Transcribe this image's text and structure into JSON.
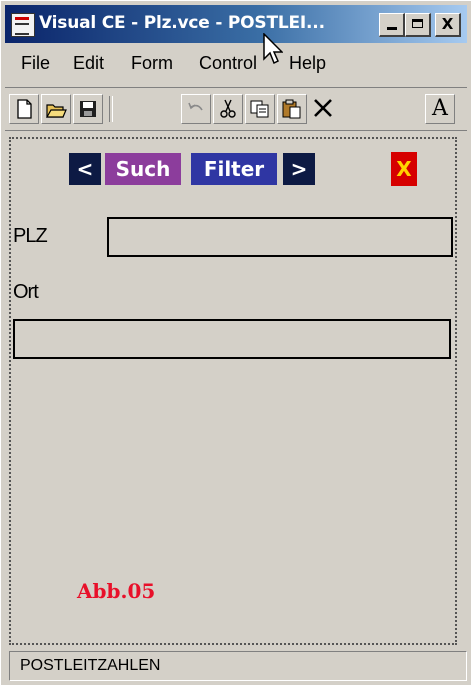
{
  "window": {
    "title": "Visual CE - Plz.vce - POSTLEI...",
    "minimize_icon": "minimize-icon",
    "maximize_icon": "maximize-icon",
    "close_label": "X"
  },
  "menu": {
    "items": [
      {
        "label": "File"
      },
      {
        "label": "Edit"
      },
      {
        "label": "Form"
      },
      {
        "label": "Control"
      },
      {
        "label": "Help"
      }
    ]
  },
  "toolbar": {
    "buttons": [
      "new-file-icon",
      "open-folder-icon",
      "save-icon",
      "undo-icon",
      "cut-icon",
      "copy-icon",
      "paste-icon",
      "delete-icon"
    ],
    "text_tool_label": "A"
  },
  "form": {
    "nav": {
      "prev_label": "<",
      "search_label": "Such",
      "filter_label": "Filter",
      "next_label": ">",
      "close_label": "X"
    },
    "fields": {
      "plz_label": "PLZ",
      "plz_value": "",
      "ort_label": "Ort",
      "ort_value": ""
    },
    "caption": "Abb.05"
  },
  "status": {
    "text": "POSTLEITZAHLEN"
  },
  "colors": {
    "title_gradient_start": "#0a246a",
    "title_gradient_end": "#a6caf0",
    "such_button": "#8c3d9c",
    "filter_button": "#2f36a3",
    "nav_arrow_button": "#0d1a44",
    "close_button_bg": "#d60000",
    "close_button_fg": "#ffd400",
    "caption": "#e8102a"
  }
}
